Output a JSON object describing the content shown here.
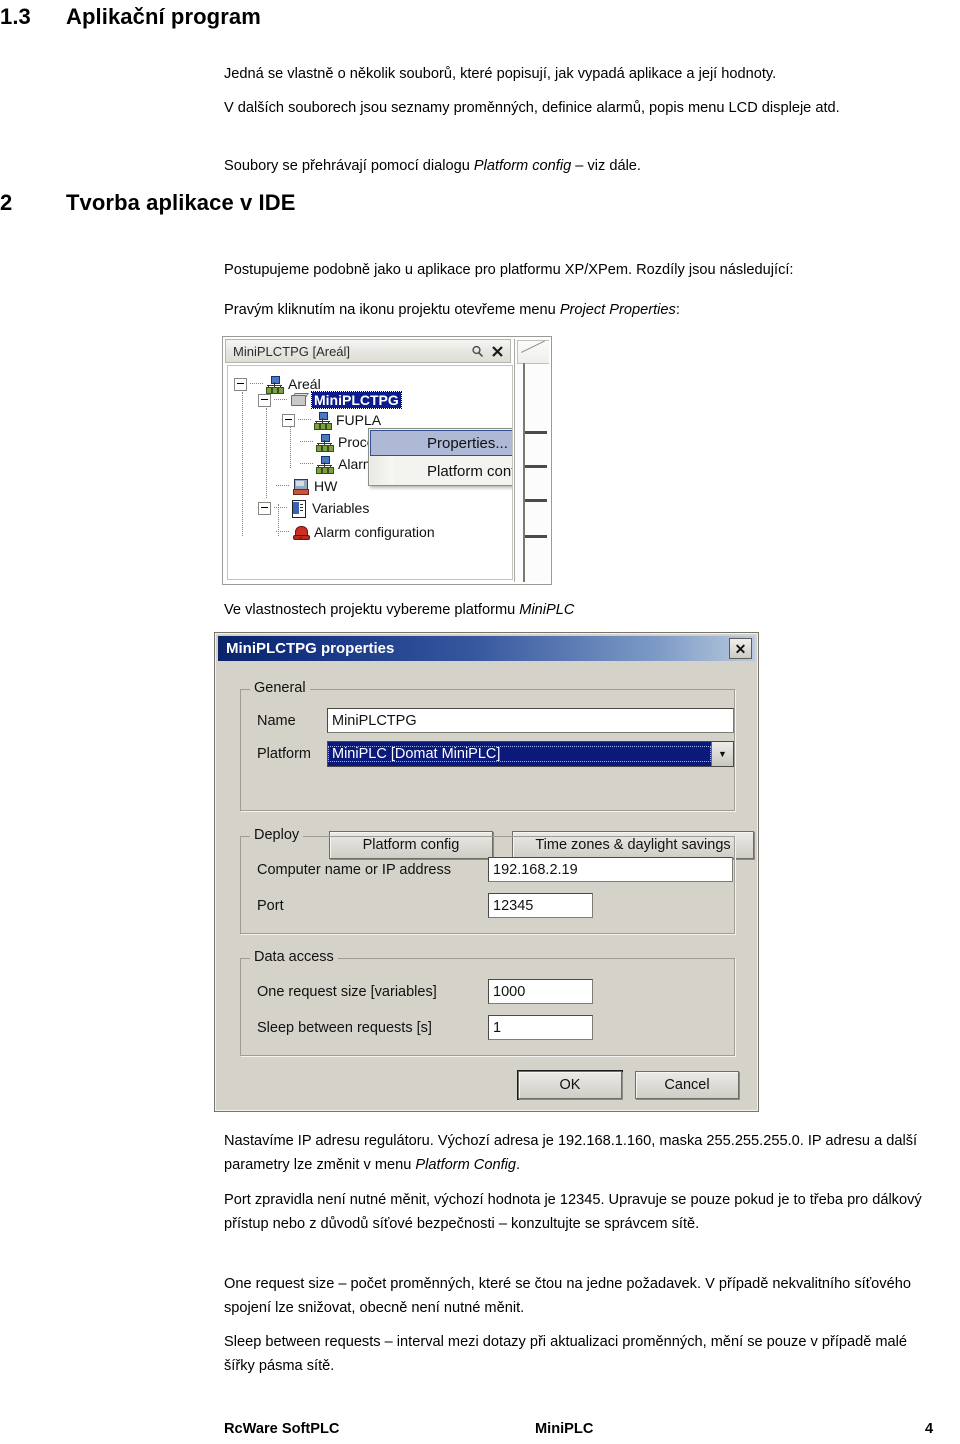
{
  "document": {
    "headings": [
      {
        "number": "1.3",
        "title": "Aplikační program"
      },
      {
        "number": "2",
        "title": "Tvorba aplikace v IDE"
      }
    ],
    "paragraphs": {
      "p1": "Jedná se vlastně o několik souborů, které popisují, jak vypadá aplikace a její hodnoty.",
      "p2": "V dalších souborech jsou seznamy proměnných, definice alarmů, popis menu LCD displeje atd.",
      "p3_pre": "Soubory se přehrávají pomocí dialogu ",
      "p3_em": "Platform config",
      "p3_post": " – viz dále.",
      "p4": "Postupujeme podobně jako u aplikace pro platformu XP/XPem. Rozdíly jsou následující:",
      "p5_pre": "Pravým kliknutím na ikonu projektu otevřeme menu ",
      "p5_em": "Project Properties",
      "p5_post": ":",
      "p6_pre": "Ve vlastnostech projektu vybereme platformu ",
      "p6_em": "MiniPLC",
      "p7_pre": "Nastavíme IP adresu regulátoru. Výchozí adresa je 192.168.1.160, maska 255.255.255.0. IP adresu a další parametry lze změnit v menu ",
      "p7_em": "Platform Config",
      "p7_post": ".",
      "p8": "Port zpravidla není nutné měnit, výchozí hodnota je 12345. Upravuje se pouze pokud je to třeba pro dálkový přístup nebo z důvodů síťové bezpečnosti – konzultujte se správcem sítě.",
      "p9": "One request size – počet proměnných, které se čtou na jedne požadavek. V případě nekvalitního síťového spojení lze snižovat, obecně není nutné měnit.",
      "p10": "Sleep between requests – interval mezi dotazy při aktualizaci proměnných, mění se pouze v případě malé šířky pásma sítě."
    },
    "footer": {
      "left": "RcWare SoftPLC",
      "middle": "MiniPLC",
      "page": "4"
    }
  },
  "tree_screenshot": {
    "titlebar": {
      "title": "MiniPLCTPG [Areál]",
      "pin_icon": "pin-icon",
      "close_icon": "close-icon"
    },
    "nodes": [
      {
        "label": "Areál",
        "icon": "network-icon"
      },
      {
        "label": "MiniPLCTPG",
        "icon": "plc-icon"
      },
      {
        "label": "FUPLA",
        "icon": "network-icon"
      },
      {
        "label": "Procesy",
        "icon": "network-icon"
      },
      {
        "label": "Alarmy",
        "icon": "network-icon"
      },
      {
        "label": "HW",
        "icon": "hardware-icon"
      },
      {
        "label": "Variables",
        "icon": "variables-icon"
      },
      {
        "label": "Alarm configuration",
        "icon": "bell-icon"
      }
    ],
    "context_menu": {
      "items": [
        {
          "label": "Properties...",
          "highlighted": true
        },
        {
          "label": "Platform config",
          "highlighted": false
        }
      ]
    }
  },
  "properties_dialog": {
    "title": "MiniPLCTPG properties",
    "close_label": "✕",
    "general": {
      "group_title": "General",
      "name_label": "Name",
      "name_value": "MiniPLCTPG",
      "platform_label": "Platform",
      "platform_value": "MiniPLC [Domat MiniPLC]",
      "platform_config_button": "Platform config",
      "timezones_button": "Time zones & daylight savings"
    },
    "deploy": {
      "group_title": "Deploy",
      "host_label": "Computer name or IP address",
      "host_value": "192.168.2.19",
      "port_label": "Port",
      "port_value": "12345"
    },
    "data_access": {
      "group_title": "Data access",
      "request_size_label": "One request size [variables]",
      "request_size_value": "1000",
      "sleep_label": "Sleep between requests [s]",
      "sleep_value": "1"
    },
    "ok_button": "OK",
    "cancel_button": "Cancel"
  },
  "colors": {
    "title_bar_blue": "#0a246a",
    "selection_blue": "#0b1a8c",
    "dialog_face": "#d5d2ca",
    "menu_highlight": "#aeb9d6"
  }
}
